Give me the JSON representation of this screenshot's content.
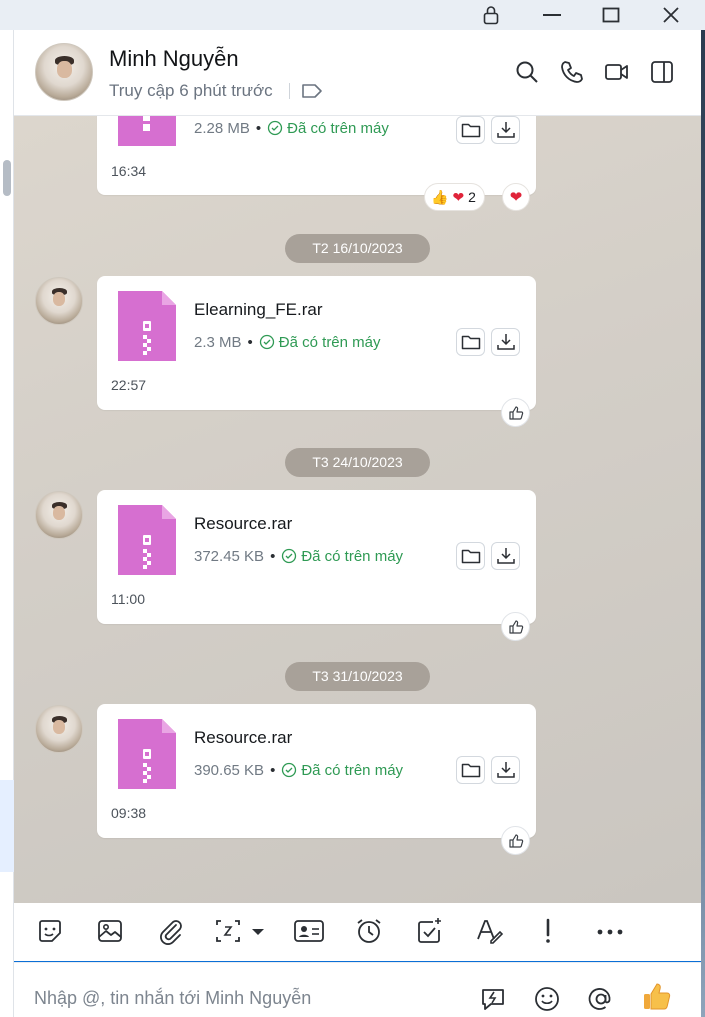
{
  "header": {
    "contact_name": "Minh Nguyễn",
    "status": "Truy cập 6 phút trước"
  },
  "messages": [
    {
      "file_name": "",
      "size": "2.28 MB",
      "status": "Đã có trên máy",
      "time": "16:34",
      "reactions": {
        "emoji": [
          "thumbs-up",
          "heart"
        ],
        "count": "2"
      }
    },
    {
      "date": "T2 16/10/2023",
      "file_name": "Elearning_FE.rar",
      "size": "2.3 MB",
      "status": "Đã có trên máy",
      "time": "22:57"
    },
    {
      "date": "T3 24/10/2023",
      "file_name": "Resource.rar",
      "size": "372.45 KB",
      "status": "Đã có trên máy",
      "time": "11:00"
    },
    {
      "date": "T3 31/10/2023",
      "file_name": "Resource.rar",
      "size": "390.65 KB",
      "status": "Đã có trên máy",
      "time": "09:38"
    }
  ],
  "input": {
    "placeholder": "Nhập @, tin nhắn tới Minh Nguyễn"
  },
  "colors": {
    "accent": "#0b6fd6",
    "file_icon": "#d66fd0",
    "status_ok": "#2f9a54",
    "date_pill": "#a8a199"
  },
  "icons": {
    "titlebar": [
      "lock-icon",
      "minimize-icon",
      "maximize-icon",
      "close-icon"
    ],
    "header": [
      "search-icon",
      "phone-icon",
      "video-icon",
      "sidebar-toggle-icon"
    ],
    "toolbar": [
      "sticker-icon",
      "image-icon",
      "attachment-icon",
      "screenshot-icon",
      "contact-card-icon",
      "reminder-icon",
      "task-icon",
      "format-text-icon",
      "important-icon",
      "more-icon"
    ],
    "input": [
      "quick-message-icon",
      "emoji-icon",
      "mention-icon",
      "thumbs-up-icon"
    ]
  }
}
